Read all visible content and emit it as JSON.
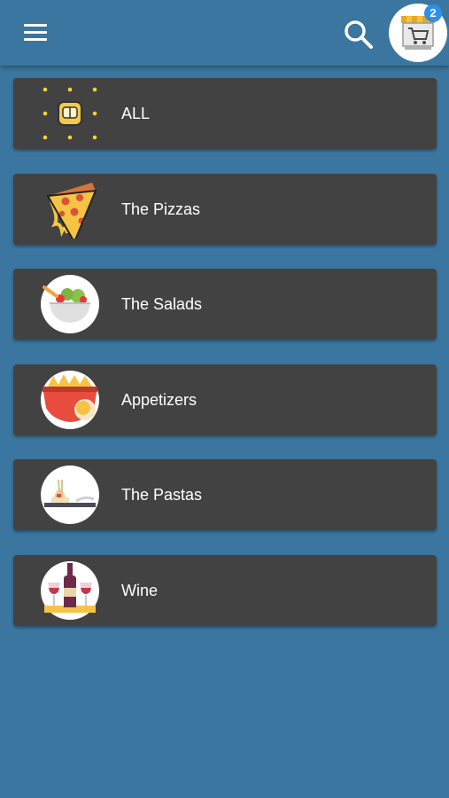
{
  "header": {
    "cart_count": "2",
    "icons": {
      "menu": "hamburger-menu-icon",
      "search": "search-icon",
      "cart": "shop-cart-icon"
    }
  },
  "categories": [
    {
      "label": "ALL",
      "icon": "all-categories-icon"
    },
    {
      "label": "The Pizzas",
      "icon": "pizza-slice-icon"
    },
    {
      "label": "The Salads",
      "icon": "salad-bowl-icon"
    },
    {
      "label": "Appetizers",
      "icon": "appetizers-icon"
    },
    {
      "label": "The Pastas",
      "icon": "pasta-icon"
    },
    {
      "label": "Wine",
      "icon": "wine-icon"
    }
  ],
  "colors": {
    "background": "#3a769f",
    "card": "#424242",
    "badge": "#2f8fe6",
    "text": "#ffffff"
  }
}
